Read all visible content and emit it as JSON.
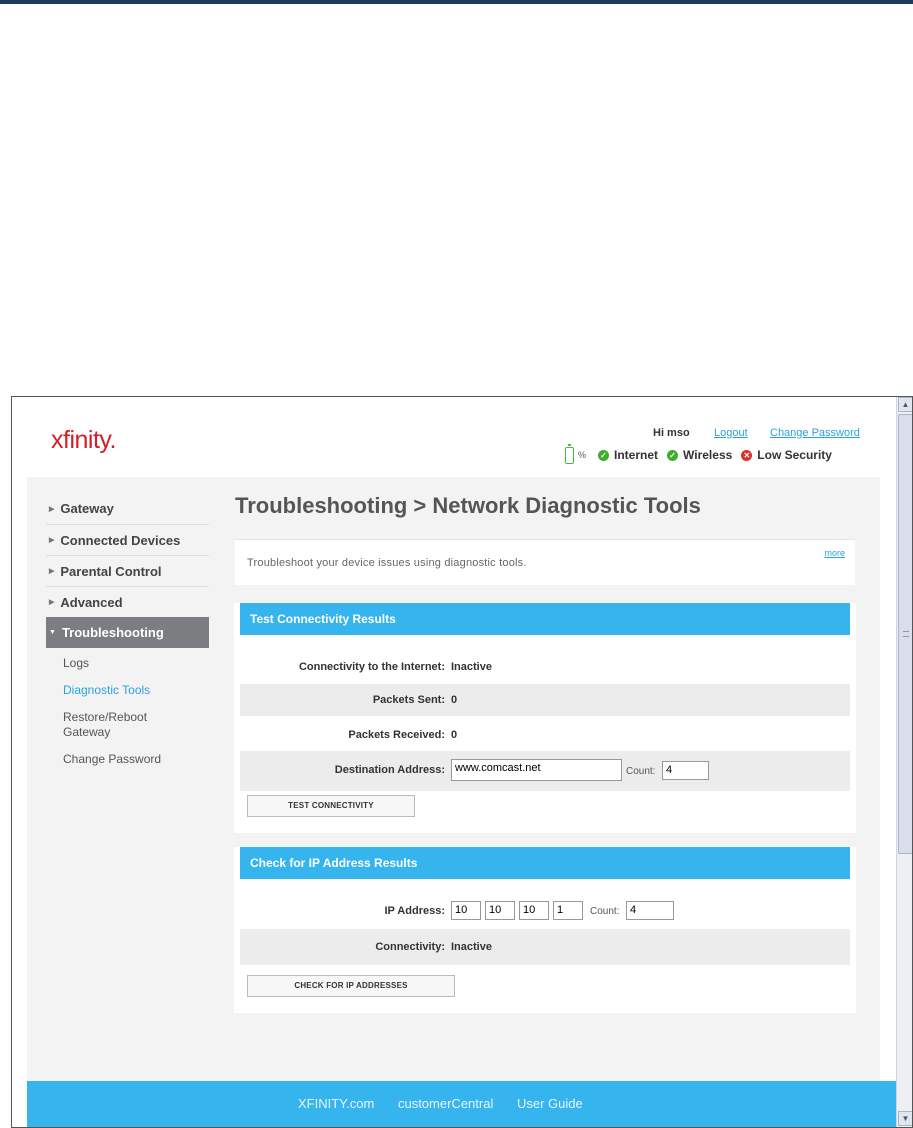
{
  "header": {
    "logo": "xfinity.",
    "greeting": "Hi mso",
    "logout": "Logout",
    "change_password": "Change Password",
    "battery_pct": "%",
    "status": [
      {
        "label": "Internet",
        "state": "ok"
      },
      {
        "label": "Wireless",
        "state": "ok"
      },
      {
        "label": "Low Security",
        "state": "warn"
      }
    ]
  },
  "sidebar": {
    "items": [
      {
        "label": "Gateway"
      },
      {
        "label": "Connected Devices"
      },
      {
        "label": "Parental Control"
      },
      {
        "label": "Advanced"
      },
      {
        "label": "Troubleshooting"
      }
    ],
    "subitems": [
      {
        "label": "Logs"
      },
      {
        "label": "Diagnostic Tools"
      },
      {
        "label": "Restore/Reboot Gateway"
      },
      {
        "label": "Change Password"
      }
    ]
  },
  "main": {
    "title": "Troubleshooting > Network Diagnostic Tools",
    "description": "Troubleshoot your device issues using diagnostic tools.",
    "more": "more",
    "connectivity_panel": {
      "heading": "Test Connectivity Results",
      "internet_label": "Connectivity to the Internet:",
      "internet_value": "Inactive",
      "sent_label": "Packets Sent:",
      "sent_value": "0",
      "received_label": "Packets Received:",
      "received_value": "0",
      "dest_label": "Destination Address:",
      "dest_value": "www.comcast.net",
      "count_label": "Count:",
      "count_value": "4",
      "button": "TEST CONNECTIVITY"
    },
    "ip_panel": {
      "heading": "Check for IP Address Results",
      "ip_label": "IP Address:",
      "ip_octets": [
        "10",
        "10",
        "10",
        "1"
      ],
      "count_label": "Count:",
      "count_value": "4",
      "connectivity_label": "Connectivity:",
      "connectivity_value": "Inactive",
      "button": "CHECK FOR IP ADDRESSES"
    }
  },
  "footer": {
    "links": [
      "XFINITY.com",
      "customerCentral",
      "User Guide"
    ]
  },
  "colors": {
    "brand_red": "#d0202b",
    "accent_blue": "#35b4ee",
    "ok_green": "#3fae2a",
    "warn_red": "#d9322a"
  }
}
